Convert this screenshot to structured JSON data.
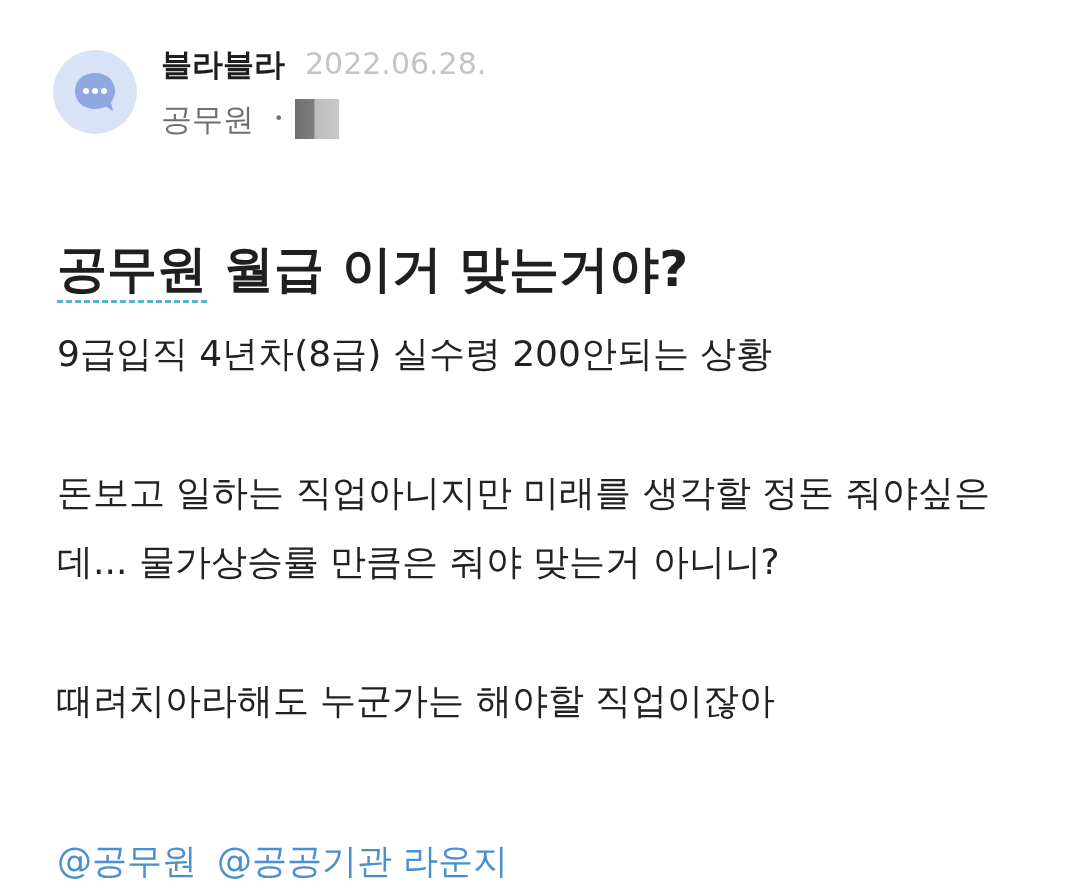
{
  "author": {
    "name": "블라블라",
    "date": "2022.06.28.",
    "company": "공무원",
    "separator": "•"
  },
  "post": {
    "title": [
      {
        "text": "공무원",
        "underlined": true
      },
      {
        "text": " 월급 이거 맞는거야?",
        "underlined": false
      }
    ],
    "paragraphs": [
      "9급입직 4년차(8급) 실수령 200안되는 상황",
      "돈보고 일하는 직업아니지만 미래를 생각할 정돈 줘야싶은데... 물가상승률 만큼은 줘야 맞는거 아니니?",
      "때려치아라해도 누군가는 해야할 직업이잖아"
    ],
    "topics": [
      "@공무원",
      "@공공기관 라운지"
    ]
  }
}
